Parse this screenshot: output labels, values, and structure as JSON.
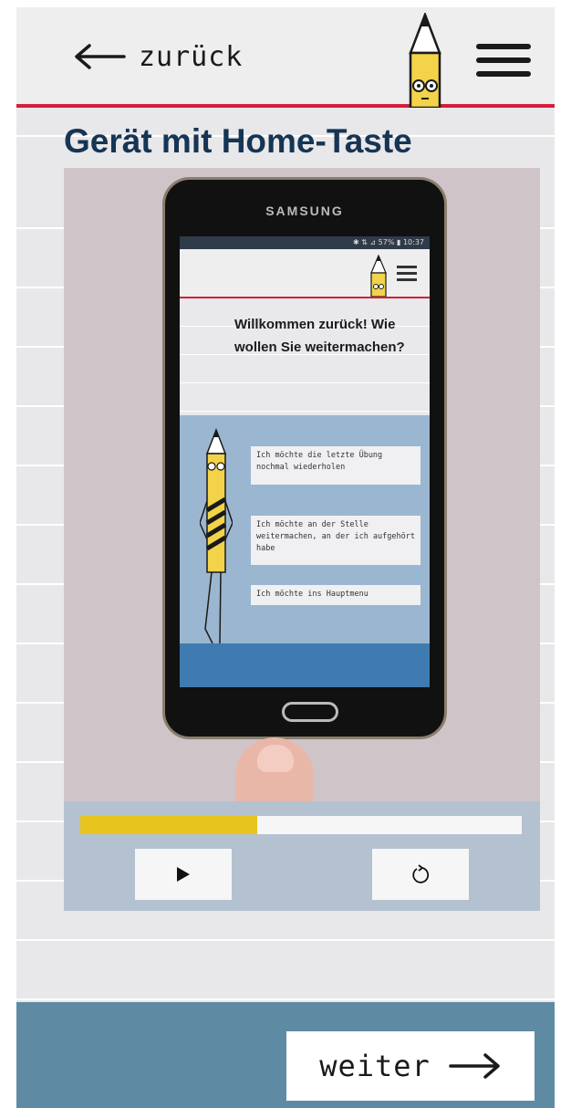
{
  "header": {
    "back_label": "zurück",
    "back_icon": "arrow-left-icon",
    "menu_icon": "hamburger-menu-icon",
    "mascot_icon": "pencil-mascot-icon"
  },
  "page": {
    "title": "Gerät mit Home-Taste"
  },
  "video": {
    "phone_brand": "SAMSUNG",
    "status_bar": "✱ ⇅ ⊿ 57% ▮ 10:37",
    "welcome_text": "Willkommen zurück! Wie wollen Sie weitermachen?",
    "choices": [
      "Ich möchte die letzte Übung nochmal wiederholen",
      "Ich möchte an der Stelle weitermachen, an der ich aufgehört habe",
      "Ich möchte ins Hauptmenu"
    ],
    "progress": 0.4,
    "play_icon": "play-icon",
    "replay_icon": "replay-icon"
  },
  "footer": {
    "next_label": "weiter",
    "next_icon": "arrow-right-icon"
  },
  "colors": {
    "accent_red": "#d41f3a",
    "title_navy": "#163554",
    "progress_yellow": "#e8c51e",
    "footer_blue": "#5e8ba3"
  }
}
